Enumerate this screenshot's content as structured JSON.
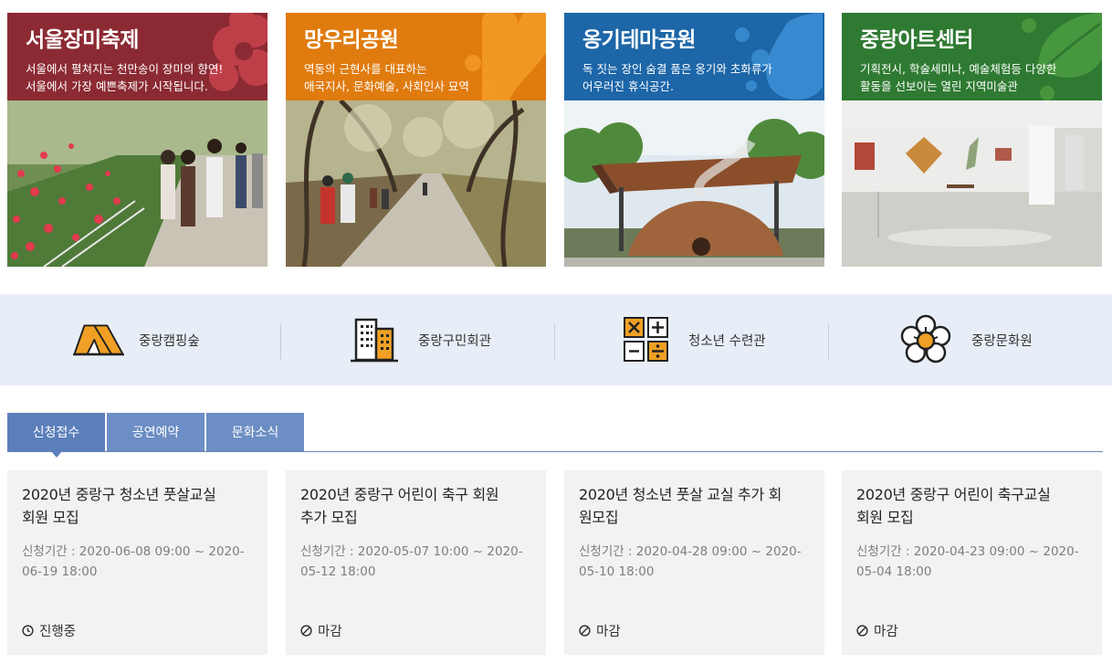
{
  "feature_cards": [
    {
      "title": "서울장미축제",
      "desc_lines": [
        "서울에서 펼쳐지는 천만송이 장미의 향연!",
        "서울에서 가장 예쁜축제가 시작됩니다."
      ],
      "color": "#8b2a33"
    },
    {
      "title": "망우리공원",
      "desc_lines": [
        "역동의 근현사를 대표하는",
        "애국지사, 문화예술, 사회인사 묘역"
      ],
      "color": "#e07b0f"
    },
    {
      "title": "옹기테마공원",
      "desc_lines": [
        "독 짓는 장인 숨결 품은 옹기와 초화류가",
        "어우러진 휴식공간."
      ],
      "color": "#1d66a8"
    },
    {
      "title": "중랑아트센터",
      "desc_lines": [
        "기획전시, 학술세미나, 예술체험등 다양한",
        "활동을 선보이는 열린 지역미술관"
      ],
      "color": "#2f7a32"
    }
  ],
  "quick_links": [
    {
      "label": "중랑캠핑숲",
      "icon": "tent-icon"
    },
    {
      "label": "중랑구민회관",
      "icon": "building-icon"
    },
    {
      "label": "청소년 수련관",
      "icon": "calculator-icon"
    },
    {
      "label": "중랑문화원",
      "icon": "flower-icon"
    }
  ],
  "tabs": [
    {
      "label": "신청접수",
      "active": true
    },
    {
      "label": "공연예약",
      "active": false
    },
    {
      "label": "문화소식",
      "active": false
    }
  ],
  "notices": [
    {
      "title_lines": [
        "2020년 중랑구 청소년 풋살교실",
        "회원 모집"
      ],
      "period_lines": [
        "신청기간 : 2020-06-08 09:00 ~ 2020-",
        "06-19 18:00"
      ],
      "status": "진행중",
      "status_icon": "clock-icon"
    },
    {
      "title_lines": [
        "2020년 중랑구 어린이 축구 회원",
        "추가 모집"
      ],
      "period_lines": [
        "신청기간 : 2020-05-07 10:00 ~ 2020-",
        "05-12 18:00"
      ],
      "status": "마감",
      "status_icon": "closed-icon"
    },
    {
      "title_lines": [
        "2020년 청소년 풋살 교실 추가 회",
        "원모집"
      ],
      "period_lines": [
        "신청기간 : 2020-04-28 09:00 ~ 2020-",
        "05-10 18:00"
      ],
      "status": "마감",
      "status_icon": "closed-icon"
    },
    {
      "title_lines": [
        "2020년 중랑구 어린이 축구교실",
        "회원 모집"
      ],
      "period_lines": [
        "신청기간 : 2020-04-23 09:00 ~ 2020-",
        "05-04 18:00"
      ],
      "status": "마감",
      "status_icon": "closed-icon"
    }
  ]
}
